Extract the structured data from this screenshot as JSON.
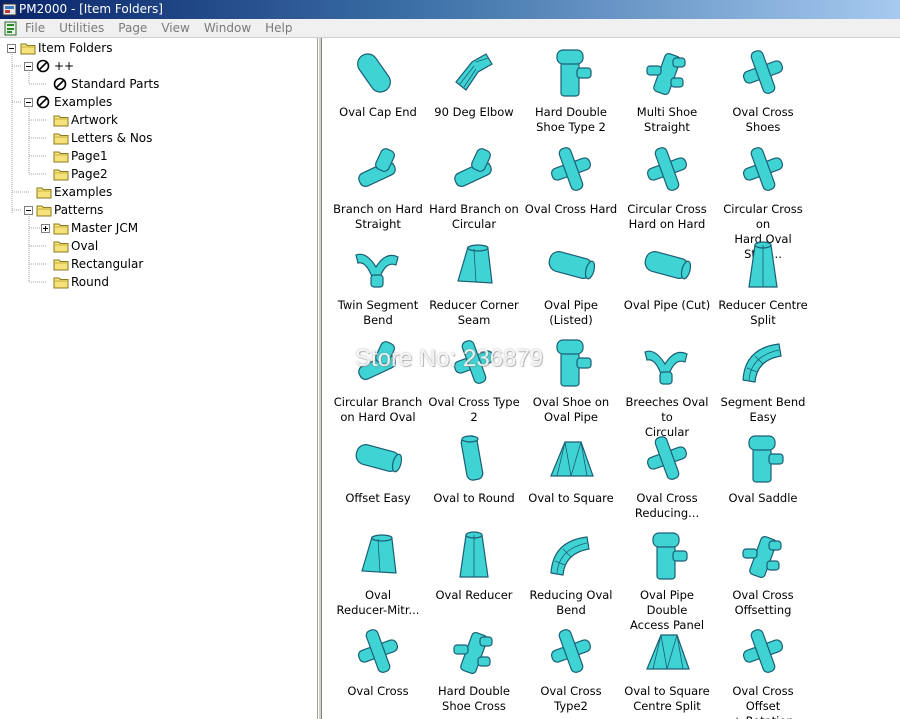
{
  "window": {
    "title": "PM2000 - [Item Folders]"
  },
  "menu": {
    "items": [
      "File",
      "Utilities",
      "Page",
      "View",
      "Window",
      "Help"
    ]
  },
  "tree": {
    "nodes": [
      {
        "label": "Item Folders",
        "icon": "folder-icon",
        "expander": "-"
      },
      {
        "label": "++",
        "icon": "no-entry-icon",
        "expander": "-"
      },
      {
        "label": "Standard Parts",
        "icon": "no-entry-icon",
        "expander": ""
      },
      {
        "label": "Examples",
        "icon": "no-entry-icon",
        "expander": "-"
      },
      {
        "label": "Artwork",
        "icon": "folder-icon",
        "expander": ""
      },
      {
        "label": "Letters & Nos",
        "icon": "folder-icon",
        "expander": ""
      },
      {
        "label": "Page1",
        "icon": "folder-icon",
        "expander": ""
      },
      {
        "label": "Page2",
        "icon": "folder-icon",
        "expander": ""
      },
      {
        "label": "Examples",
        "icon": "folder-icon",
        "expander": ""
      },
      {
        "label": "Patterns",
        "icon": "folder-icon",
        "expander": "-"
      },
      {
        "label": "Master JCM",
        "icon": "folder-icon",
        "expander": "+"
      },
      {
        "label": "Oval",
        "icon": "folder-icon",
        "expander": ""
      },
      {
        "label": "Rectangular",
        "icon": "folder-icon",
        "expander": ""
      },
      {
        "label": "Round",
        "icon": "folder-icon",
        "expander": ""
      }
    ]
  },
  "items": [
    {
      "line1": "Oval Cap End",
      "line2": "",
      "shape": "capsule"
    },
    {
      "line1": "90 Deg Elbow",
      "line2": "",
      "shape": "elbow"
    },
    {
      "line1": "Hard Double",
      "line2": "Shoe Type 2",
      "shape": "tee"
    },
    {
      "line1": "Multi Shoe",
      "line2": "Straight",
      "shape": "multi"
    },
    {
      "line1": "Oval Cross Shoes",
      "line2": "",
      "shape": "cross"
    },
    {
      "line1": "Branch on Hard",
      "line2": "Straight",
      "shape": "branch"
    },
    {
      "line1": "Hard Branch on",
      "line2": "Circular",
      "shape": "branch"
    },
    {
      "line1": "Oval Cross Hard",
      "line2": "",
      "shape": "cross"
    },
    {
      "line1": "Circular Cross",
      "line2": "Hard on Hard",
      "shape": "cross"
    },
    {
      "line1": "Circular Cross on",
      "line2": "Hard Oval Strai...",
      "shape": "cross"
    },
    {
      "line1": "Twin Segment",
      "line2": "Bend",
      "shape": "twin"
    },
    {
      "line1": "Reducer Corner",
      "line2": "Seam",
      "shape": "reducer"
    },
    {
      "line1": "Oval Pipe (Listed)",
      "line2": "",
      "shape": "pipe"
    },
    {
      "line1": "Oval Pipe (Cut)",
      "line2": "",
      "shape": "pipe"
    },
    {
      "line1": "Reducer Centre",
      "line2": "Split",
      "shape": "cone"
    },
    {
      "line1": "Circular Branch",
      "line2": "on Hard Oval",
      "shape": "branch"
    },
    {
      "line1": "Oval Cross Type",
      "line2": "2",
      "shape": "cross"
    },
    {
      "line1": "Oval Shoe on",
      "line2": "Oval Pipe",
      "shape": "tee"
    },
    {
      "line1": "Breeches Oval to",
      "line2": "Circular",
      "shape": "twin"
    },
    {
      "line1": "Segment Bend",
      "line2": "Easy",
      "shape": "bend"
    },
    {
      "line1": "Offset Easy",
      "line2": "",
      "shape": "pipe"
    },
    {
      "line1": "Oval to Round",
      "line2": "",
      "shape": "cylinder"
    },
    {
      "line1": "Oval to Square",
      "line2": "",
      "shape": "square"
    },
    {
      "line1": "Oval Cross",
      "line2": "Reducing...",
      "shape": "cross"
    },
    {
      "line1": "Oval Saddle",
      "line2": "",
      "shape": "tee"
    },
    {
      "line1": "Oval",
      "line2": "Reducer-Mitr...",
      "shape": "reducer"
    },
    {
      "line1": "Oval Reducer",
      "line2": "",
      "shape": "cone"
    },
    {
      "line1": "Reducing Oval",
      "line2": "Bend",
      "shape": "bend"
    },
    {
      "line1": "Oval Pipe Double",
      "line2": "Access Panel",
      "shape": "tee"
    },
    {
      "line1": "Oval Cross",
      "line2": "Offsetting",
      "shape": "multi"
    },
    {
      "line1": "Oval Cross",
      "line2": "",
      "shape": "cross"
    },
    {
      "line1": "Hard Double",
      "line2": "Shoe Cross",
      "shape": "multi"
    },
    {
      "line1": "Oval Cross Type2",
      "line2": "",
      "shape": "cross"
    },
    {
      "line1": "Oval to Square",
      "line2": "Centre Split",
      "shape": "square"
    },
    {
      "line1": "Oval Cross Offset",
      "line2": "+ Rotation",
      "shape": "cross"
    }
  ],
  "watermark": "Store No: 236879",
  "colors": {
    "part_fill": "#3fd3d3",
    "part_stroke": "#1a5f74",
    "title_bar": "#0a246a"
  }
}
